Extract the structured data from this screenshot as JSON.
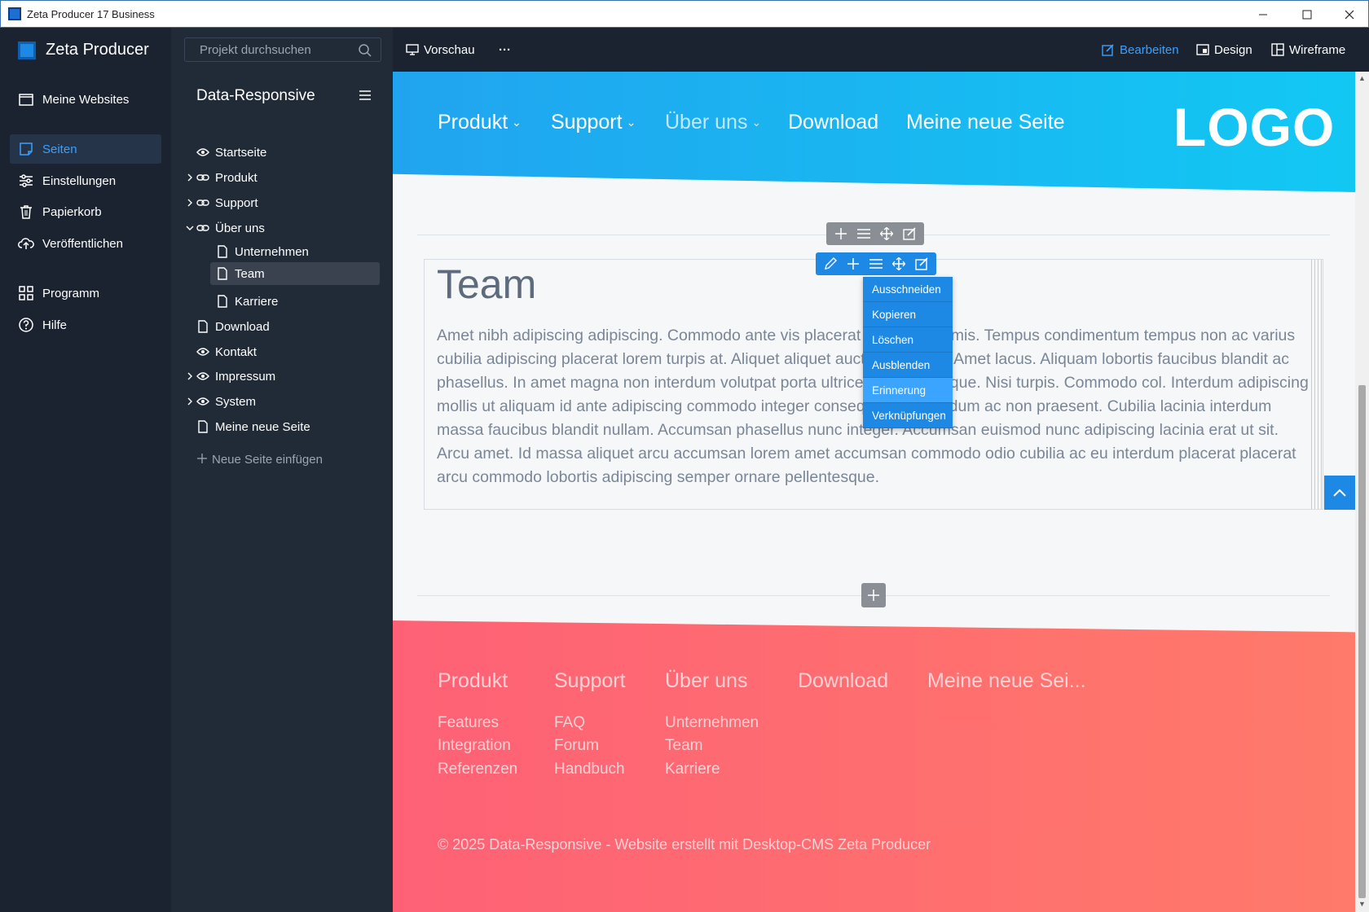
{
  "window": {
    "title": "Zeta Producer 17 Business"
  },
  "brand": {
    "name": "Zeta Producer"
  },
  "leftnav": {
    "items": [
      {
        "label": "Meine Websites",
        "icon": "browser-window-icon"
      },
      {
        "label": "Seiten",
        "icon": "pages-icon",
        "active": true
      },
      {
        "label": "Einstellungen",
        "icon": "sliders-icon"
      },
      {
        "label": "Papierkorb",
        "icon": "trash-icon"
      },
      {
        "label": "Veröffentlichen",
        "icon": "cloud-upload-icon"
      },
      {
        "label": "Programm",
        "icon": "grid-icon"
      },
      {
        "label": "Hilfe",
        "icon": "help-circle-icon"
      }
    ]
  },
  "search": {
    "placeholder": "Projekt durchsuchen"
  },
  "tree": {
    "project_title": "Data-Responsive",
    "items": [
      {
        "label": "Startseite",
        "icon": "eye-icon"
      },
      {
        "label": "Produkt",
        "icon": "link-icon"
      },
      {
        "label": "Support",
        "icon": "link-icon"
      },
      {
        "label": "Über uns",
        "icon": "link-icon"
      },
      {
        "label": "Unternehmen",
        "icon": "page-icon"
      },
      {
        "label": "Team",
        "icon": "page-icon",
        "selected": true
      },
      {
        "label": "Karriere",
        "icon": "page-icon"
      },
      {
        "label": "Download",
        "icon": "page-icon"
      },
      {
        "label": "Kontakt",
        "icon": "eye-icon"
      },
      {
        "label": "Impressum",
        "icon": "eye-icon"
      },
      {
        "label": "System",
        "icon": "eye-icon"
      },
      {
        "label": "Meine neue Seite",
        "icon": "page-icon"
      }
    ],
    "add_page": "Neue Seite einfügen"
  },
  "toolbar": {
    "preview": "Vorschau",
    "more": "···",
    "edit": "Bearbeiten",
    "design": "Design",
    "wireframe": "Wireframe"
  },
  "site": {
    "nav": [
      "Produkt",
      "Support",
      "Über uns",
      "Download",
      "Meine neue Seite"
    ],
    "logo": "LOGO",
    "heading": "Team",
    "body": "Amet nibh adipiscing adipiscing. Commodo ante vis placerat in massa primis. Tempus condimentum tempus non ac varius cubilia adipiscing placerat lorem turpis at. Aliquet aliquet auctor interdum. Amet lacus. Aliquam lobortis faucibus blandit ac phasellus. In amet magna non interdum volutpat porta ultrices ante ac neque. Nisi turpis. Commodo col. Interdum adipiscing mollis ut aliquam id ante adipiscing commodo integer consequat. Ac interdum ac non praesent. Cubilia lacinia inter­dum massa faucibus blandit nullam. Accumsan phasellus nunc integer. Accumsan euismod nunc adipiscing lacinia erat ut sit. Arcu amet. Id massa aliquet arcu accumsan lorem amet accumsan commodo odio cubilia ac eu interdum placerat placerat arcu commodo lobortis adipiscing semper ornare pellentesque.",
    "footer": {
      "columns": [
        {
          "title": "Produkt",
          "links": [
            "Features",
            "Integration",
            "Referenzen"
          ]
        },
        {
          "title": "Support",
          "links": [
            "FAQ",
            "Forum",
            "Handbuch"
          ]
        },
        {
          "title": "Über uns",
          "links": [
            "Unternehmen",
            "Team",
            "Karriere"
          ]
        },
        {
          "title": "Download",
          "links": []
        },
        {
          "title": "Meine neue Sei...",
          "links": []
        }
      ],
      "copyright": "© 2025 Data-Responsive - Website erstellt mit Desktop-CMS Zeta Producer"
    }
  },
  "context_menu": {
    "items": [
      "Ausschneiden",
      "Kopieren",
      "Löschen",
      "Ausblenden",
      "Erinnerung",
      "Verknüpfungen"
    ],
    "highlighted": "Erinnerung"
  },
  "colors": {
    "accent": "#1e88e5",
    "header_gradient_start": "#21a4ef",
    "header_gradient_end": "#12c8f3",
    "footer_gradient_start": "#fe6176",
    "footer_gradient_end": "#ff7a6a"
  }
}
